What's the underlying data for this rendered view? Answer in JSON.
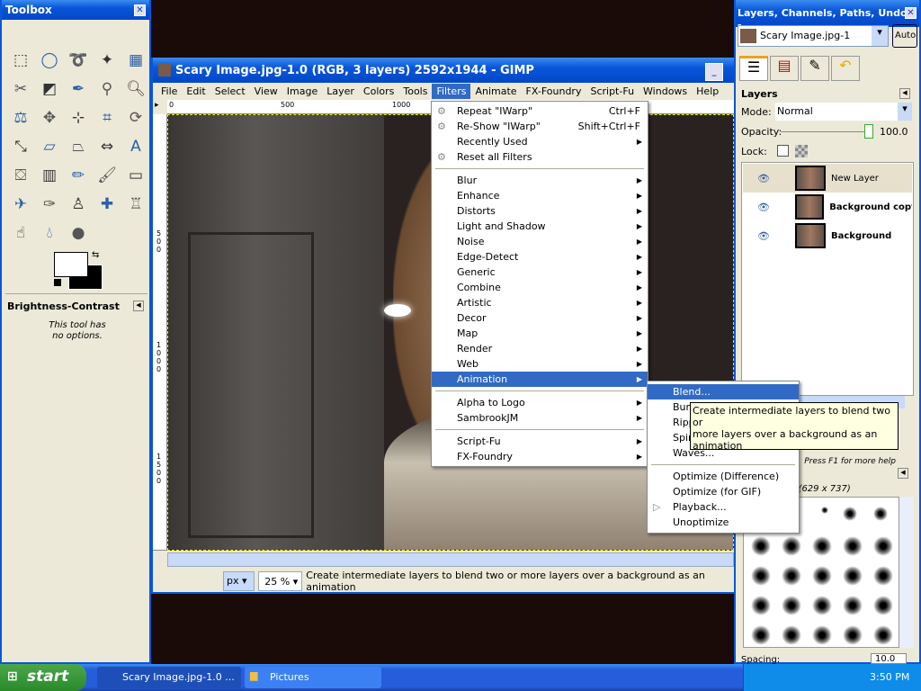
{
  "toolbox": {
    "title": "Toolbox",
    "tool_options_title": "Brightness-Contrast",
    "tool_options_text1": "This tool has",
    "tool_options_text2": "no options.",
    "tools": [
      "rect-select",
      "ellipse-select",
      "free-select",
      "fuzzy-select",
      "color-select",
      "scissors",
      "foreground-select",
      "paths",
      "color-picker",
      "zoom",
      "measure",
      "move",
      "align",
      "crop",
      "rotate",
      "scale",
      "shear",
      "perspective",
      "flip",
      "text",
      "bucket-fill",
      "blend",
      "pencil",
      "paintbrush",
      "eraser",
      "airbrush",
      "ink",
      "clone",
      "heal",
      "perspective-clone",
      "smudge",
      "blur",
      "dodge-burn"
    ],
    "fg_color": "#ffffff",
    "bg_color": "#000000"
  },
  "image_window": {
    "title": "Scary Image.jpg-1.0 (RGB, 3 layers) 2592x1944 - GIMP",
    "menu": [
      "File",
      "Edit",
      "Select",
      "View",
      "Image",
      "Layer",
      "Colors",
      "Tools",
      "Filters",
      "Animate",
      "FX-Foundry",
      "Script-Fu",
      "Windows",
      "Help"
    ],
    "ruler_h": [
      "0",
      "500",
      "1000"
    ],
    "ruler_v": [
      "500",
      "1000",
      "1500"
    ],
    "unit": "px",
    "zoom": "25 %",
    "status": "Create intermediate layers to blend two or more layers over a background as an animation"
  },
  "filters_menu": {
    "items": [
      {
        "label": "Repeat \"IWarp\"",
        "shortcut": "Ctrl+F",
        "icon": "repeat-icon"
      },
      {
        "label": "Re-Show \"IWarp\"",
        "shortcut": "Shift+Ctrl+F",
        "icon": "reshow-icon"
      },
      {
        "label": "Recently Used",
        "submenu": true
      },
      {
        "label": "Reset all Filters",
        "icon": "reset-icon"
      },
      {
        "sep": true
      },
      {
        "label": "Blur",
        "submenu": true
      },
      {
        "label": "Enhance",
        "submenu": true
      },
      {
        "label": "Distorts",
        "submenu": true
      },
      {
        "label": "Light and Shadow",
        "submenu": true
      },
      {
        "label": "Noise",
        "submenu": true
      },
      {
        "label": "Edge-Detect",
        "submenu": true
      },
      {
        "label": "Generic",
        "submenu": true
      },
      {
        "label": "Combine",
        "submenu": true
      },
      {
        "label": "Artistic",
        "submenu": true
      },
      {
        "label": "Decor",
        "submenu": true
      },
      {
        "label": "Map",
        "submenu": true
      },
      {
        "label": "Render",
        "submenu": true
      },
      {
        "label": "Web",
        "submenu": true
      },
      {
        "label": "Animation",
        "submenu": true,
        "selected": true
      },
      {
        "sep": true
      },
      {
        "label": "Alpha to Logo",
        "submenu": true
      },
      {
        "label": "SambrookJM",
        "submenu": true
      },
      {
        "sep": true
      },
      {
        "label": "Script-Fu",
        "submenu": true
      },
      {
        "label": "FX-Foundry",
        "submenu": true
      }
    ]
  },
  "animation_menu": {
    "items": [
      {
        "label": "Blend...",
        "selected": true
      },
      {
        "label": "Burn-In..."
      },
      {
        "label": "Rippling..."
      },
      {
        "label": "Spinning Globe..."
      },
      {
        "label": "Waves..."
      },
      {
        "sep": true
      },
      {
        "label": "Optimize (Difference)"
      },
      {
        "label": "Optimize (for GIF)"
      },
      {
        "label": "Playback...",
        "icon": "play-icon"
      },
      {
        "label": "Unoptimize"
      }
    ]
  },
  "tooltip": {
    "line1": "Create intermediate layers to blend two or",
    "line2": "more layers over a background as an animation",
    "help": "Press F1 for more help"
  },
  "dock": {
    "title": "Layers, Channels, Paths, Undo -...",
    "image_select": "Scary Image.jpg-1",
    "auto": "Auto",
    "tabs": [
      "layers-icon",
      "channels-icon",
      "paths-icon",
      "undo-icon"
    ],
    "layers_title": "Layers",
    "mode_label": "Mode:",
    "mode": "Normal",
    "opacity_label": "Opacity:",
    "opacity": "100.0",
    "lock_label": "Lock:",
    "layers": [
      {
        "name": "New Layer",
        "selected": true,
        "visible": true
      },
      {
        "name": "Background copy",
        "visible": true
      },
      {
        "name": "Background",
        "visible": true
      }
    ],
    "brushes_info": "3 (629 x 737)",
    "spacing_label": "Spacing:",
    "spacing": "10.0"
  },
  "taskbar": {
    "start": "start",
    "tasks": [
      "Scary Image.jpg-1.0 ...",
      "Pictures"
    ],
    "clock": "3:50 PM"
  }
}
